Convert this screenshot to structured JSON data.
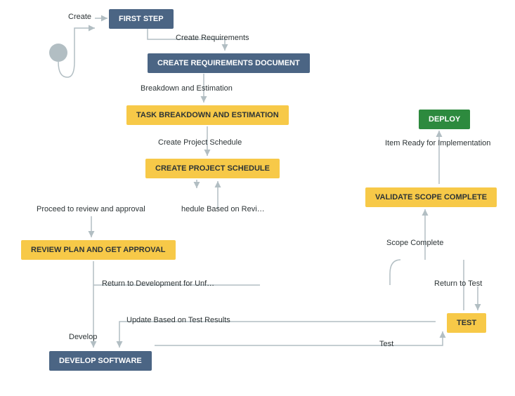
{
  "start_label": "Create",
  "nodes": {
    "first_step": "FIRST STEP",
    "create_requirements_doc": "CREATE REQUIREMENTS DOCUMENT",
    "task_breakdown": "TASK BREAKDOWN AND ESTIMATION",
    "create_schedule": "CREATE PROJECT SCHEDULE",
    "review_plan": "REVIEW PLAN AND GET APPROVAL",
    "develop_software": "DEVELOP SOFTWARE",
    "test": "TEST",
    "validate_scope": "VALIDATE SCOPE COMPLETE",
    "deploy": "DEPLOY"
  },
  "edges": {
    "create_requirements": "Create Requirements",
    "breakdown_estimation": "Breakdown and Estimation",
    "create_project_schedule": "Create Project Schedule",
    "proceed_review": "Proceed to review and approval",
    "schedule_based_on_review": "hedule Based on Revi…",
    "return_dev_unf": "Return to Development for Unf…",
    "update_test_results": "Update Based on Test Results",
    "develop": "Develop",
    "test": "Test",
    "return_to_test": "Return to Test",
    "scope_complete": "Scope Complete",
    "item_ready_impl": "Item Ready for Implementation"
  },
  "colors": {
    "blue": "#4b6584",
    "yellow": "#f7c948",
    "green": "#2d8a3e",
    "line": "#b2bec3",
    "start": "#b2bec3"
  }
}
